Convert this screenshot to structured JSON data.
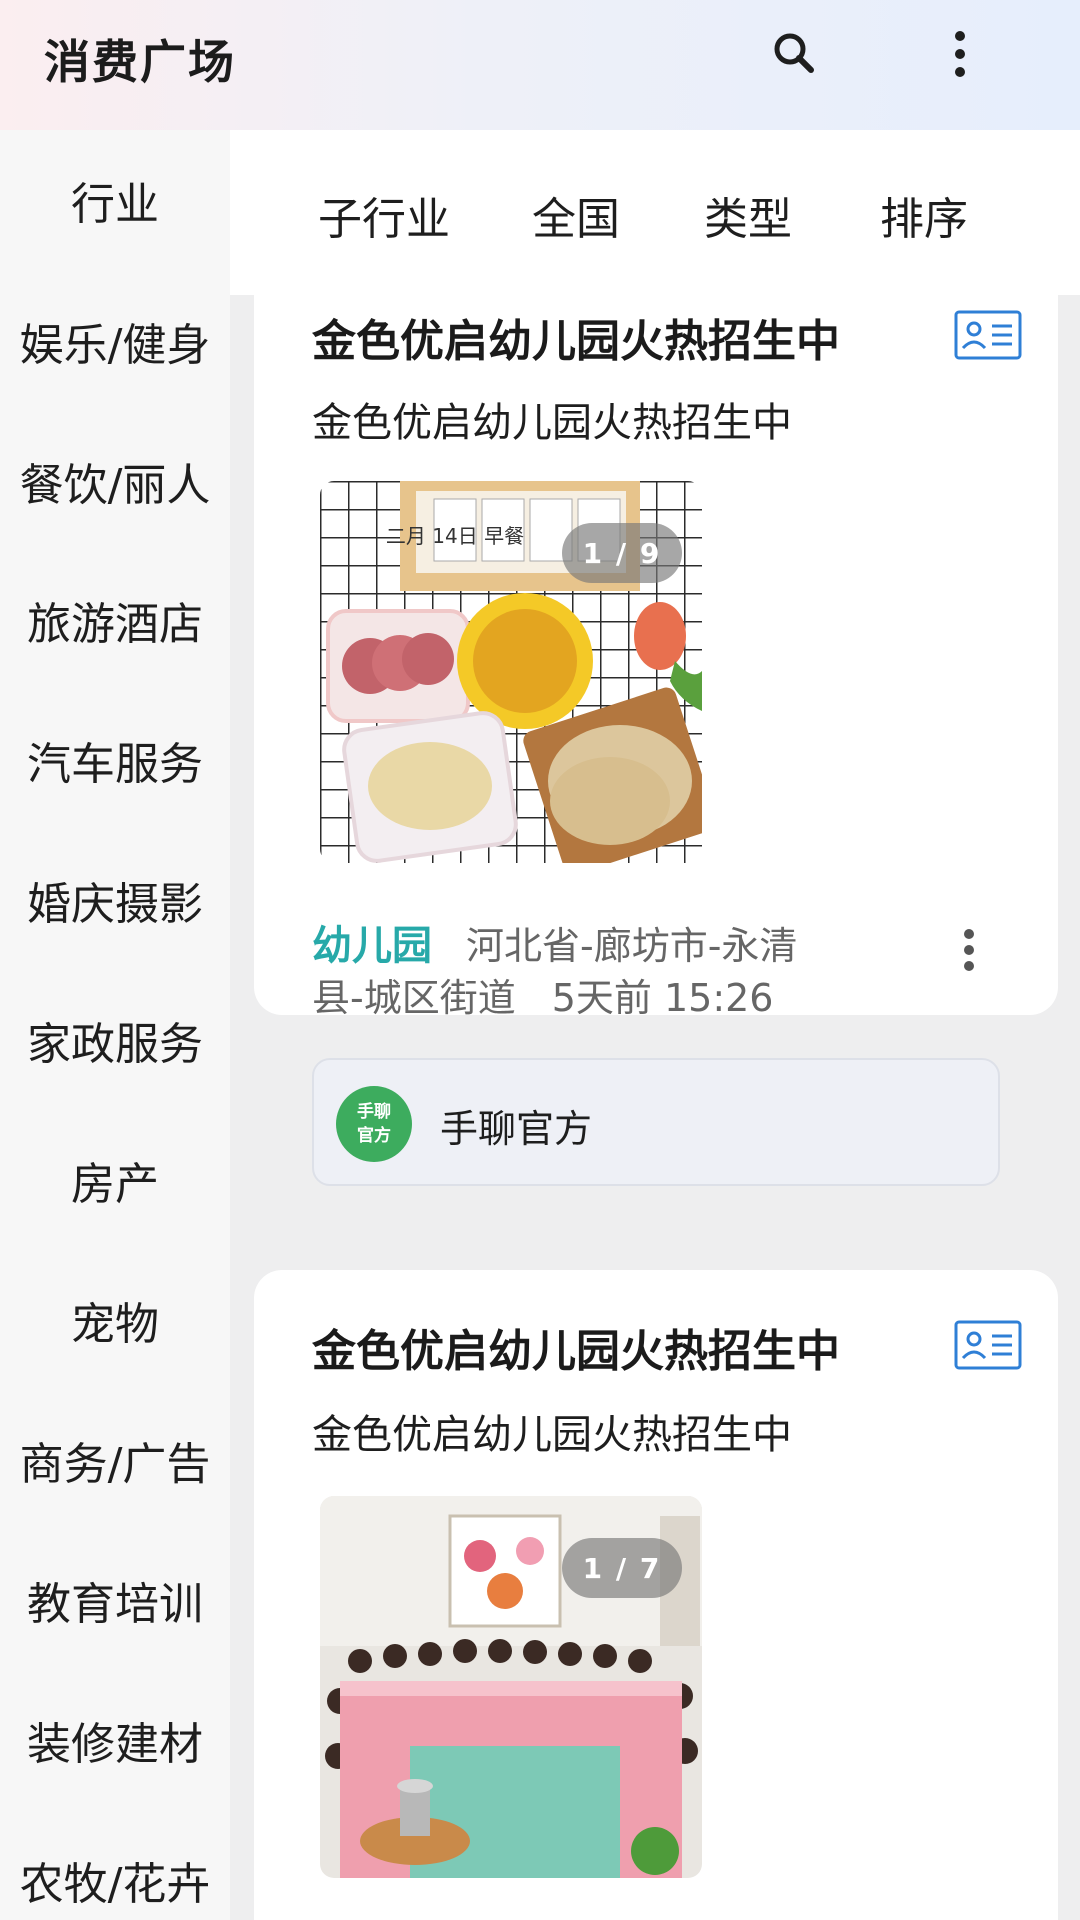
{
  "appbar": {
    "title": "消费广场",
    "search_icon": "search-icon",
    "more_icon": "more-vertical-icon"
  },
  "sidebar": {
    "header": "行业",
    "items": [
      {
        "label": "娱乐/健身"
      },
      {
        "label": "餐饮/丽人"
      },
      {
        "label": "旅游酒店"
      },
      {
        "label": "汽车服务"
      },
      {
        "label": "婚庆摄影"
      },
      {
        "label": "家政服务"
      },
      {
        "label": "房产"
      },
      {
        "label": "宠物"
      },
      {
        "label": "商务/广告"
      },
      {
        "label": "教育培训"
      },
      {
        "label": "装修建材"
      },
      {
        "label": "农牧/花卉"
      }
    ]
  },
  "filters": [
    {
      "label": "子行业"
    },
    {
      "label": "全国"
    },
    {
      "label": "类型"
    },
    {
      "label": "排序"
    }
  ],
  "cards": [
    {
      "title": "金色优启幼儿园火热招生中",
      "subtitle": "金色优启幼儿园火热招生中",
      "photo_counter": "1 / 9",
      "photo_subject": "breakfast tray with ham, millet porridge, pancakes and calendar sign",
      "calendar_text": "二月 14日 早餐",
      "tag": "幼儿园",
      "location_line1": "河北省-廊坊市-永清",
      "location_line2": "县-城区街道",
      "time": "5天前 15:26",
      "publisher_avatar_line1": "手聊",
      "publisher_avatar_line2": "官方",
      "publisher_name": "手聊官方"
    },
    {
      "title": "金色优启幼儿园火热招生中",
      "subtitle": "金色优启幼儿园火热招生中",
      "photo_counter": "1 / 7",
      "photo_subject": "children seated around tables with pink checkered tablecloths"
    }
  ],
  "colors": {
    "accent_teal": "#27a9a9",
    "icon_blue": "#2f7fd6",
    "avatar_green": "#3dac5e"
  }
}
